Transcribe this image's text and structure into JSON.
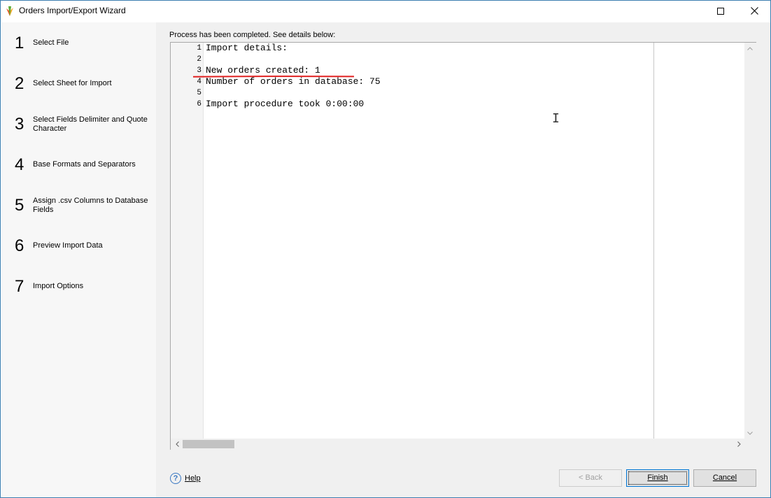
{
  "window": {
    "title": "Orders Import/Export Wizard"
  },
  "sidebar": {
    "steps": [
      {
        "number": "1",
        "label": "Select File"
      },
      {
        "number": "2",
        "label": "Select Sheet for Import"
      },
      {
        "number": "3",
        "label": "Select Fields Delimiter and Quote Character"
      },
      {
        "number": "4",
        "label": "Base Formats and Separators"
      },
      {
        "number": "5",
        "label": "Assign .csv Columns to Database Fields"
      },
      {
        "number": "6",
        "label": "Preview Import Data"
      },
      {
        "number": "7",
        "label": "Import Options"
      }
    ]
  },
  "main": {
    "status": "Process has been completed. See details below:",
    "log_lines": [
      {
        "num": "1",
        "text": "Import details:"
      },
      {
        "num": "2",
        "text": ""
      },
      {
        "num": "3",
        "text": "New orders created: 1"
      },
      {
        "num": "4",
        "text": "Number of orders in database: 75"
      },
      {
        "num": "5",
        "text": ""
      },
      {
        "num": "6",
        "text": "Import procedure took 0:00:00"
      }
    ]
  },
  "footer": {
    "help_label": "Help",
    "back_label": "< Back",
    "finish_label": "Finish",
    "cancel_label": "Cancel"
  },
  "colors": {
    "highlight_underline": "#e02020",
    "window_border": "#3c7fb1",
    "primary_button_border": "#0078d7"
  },
  "icons": {
    "app": "app-logo-icon",
    "maximize": "maximize-icon",
    "close": "close-icon",
    "help": "help-icon"
  }
}
